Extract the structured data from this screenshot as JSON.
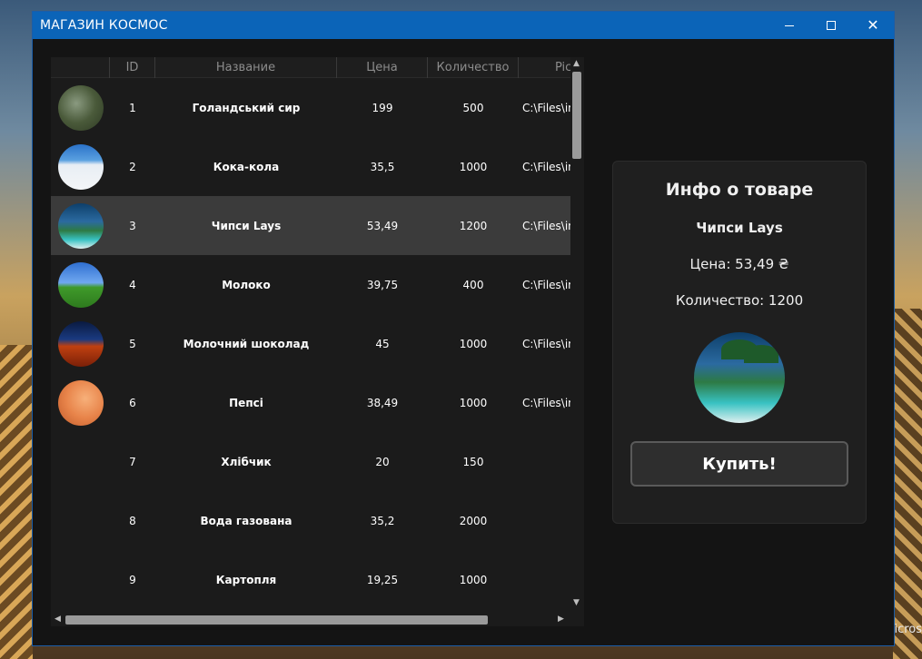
{
  "window": {
    "title": "МАГАЗИН КОСМОС"
  },
  "grid": {
    "columns": [
      "",
      "ID",
      "Название",
      "Цена",
      "Количество",
      "Pic"
    ],
    "rows": [
      {
        "id": "1",
        "name": "Голандський сир",
        "price": "199",
        "qty": "500",
        "path": "C:\\Files\\im",
        "has_pic": true
      },
      {
        "id": "2",
        "name": "Кока-кола",
        "price": "35,5",
        "qty": "1000",
        "path": "C:\\Files\\im",
        "has_pic": true
      },
      {
        "id": "3",
        "name": "Чипси Lays",
        "price": "53,49",
        "qty": "1200",
        "path": "C:\\Files\\im",
        "has_pic": true,
        "selected": true
      },
      {
        "id": "4",
        "name": "Молоко",
        "price": "39,75",
        "qty": "400",
        "path": "C:\\Files\\im",
        "has_pic": true
      },
      {
        "id": "5",
        "name": "Молочний шоколад",
        "price": "45",
        "qty": "1000",
        "path": "C:\\Files\\im",
        "has_pic": true
      },
      {
        "id": "6",
        "name": "Пепсі",
        "price": "38,49",
        "qty": "1000",
        "path": "C:\\Files\\im",
        "has_pic": true
      },
      {
        "id": "7",
        "name": "Хлібчик",
        "price": "20",
        "qty": "150",
        "path": "",
        "has_pic": false
      },
      {
        "id": "8",
        "name": "Вода газована",
        "price": "35,2",
        "qty": "2000",
        "path": "",
        "has_pic": false
      },
      {
        "id": "9",
        "name": "Картопля",
        "price": "19,25",
        "qty": "1000",
        "path": "",
        "has_pic": false
      }
    ]
  },
  "info": {
    "title": "Инфо о товаре",
    "name": "Чипси Lays",
    "price": "Цена: 53,49 ₴",
    "qty": "Количество: 1200",
    "buy_label": "Купить!"
  },
  "desktop": {
    "watermark": "icros"
  },
  "colors": {
    "titlebar": "#0b64b8",
    "selected_row": "#3b3b3b",
    "panel": "#1f1f1f"
  }
}
